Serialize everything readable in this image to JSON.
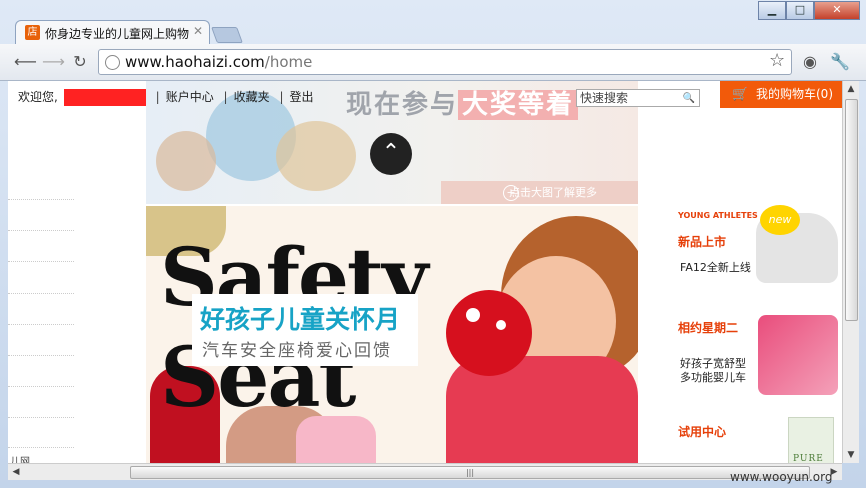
{
  "browser": {
    "tab_title": "你身边专业的儿童网上购物",
    "tab_favicon": "店",
    "url_host": "www.haohaizi.com",
    "url_path": "/home"
  },
  "header": {
    "welcome": "欢迎您,",
    "account": "账户中心",
    "favorites": "收藏夹",
    "logout": "登出",
    "sep": "|",
    "search_placeholder": "快速搜索",
    "cart_label": "我的购物车(0)",
    "cart_color": "#f25a0a"
  },
  "hero": {
    "text_a": "现在参与",
    "text_b": "大奖等着",
    "bottom_label": "点击大图了解更多"
  },
  "banner": {
    "word1": "Safety",
    "word2": "Seat",
    "title": "好孩子儿童关怀月",
    "subtitle": "汽车安全座椅爱心回馈",
    "title_color": "#17a3c6"
  },
  "side_ads": [
    {
      "logo": "YOUNG ATHLETES",
      "heading": "新品上市",
      "text": "FA12全新上线",
      "badge": "new"
    },
    {
      "heading": "相约星期二",
      "text1": "好孩子宽舒型",
      "text2": "多功能婴儿车"
    },
    {
      "heading": "试用中心",
      "product": "PURE"
    }
  ],
  "left_bottom": "儿网",
  "watermark": "www.wooyun.org"
}
